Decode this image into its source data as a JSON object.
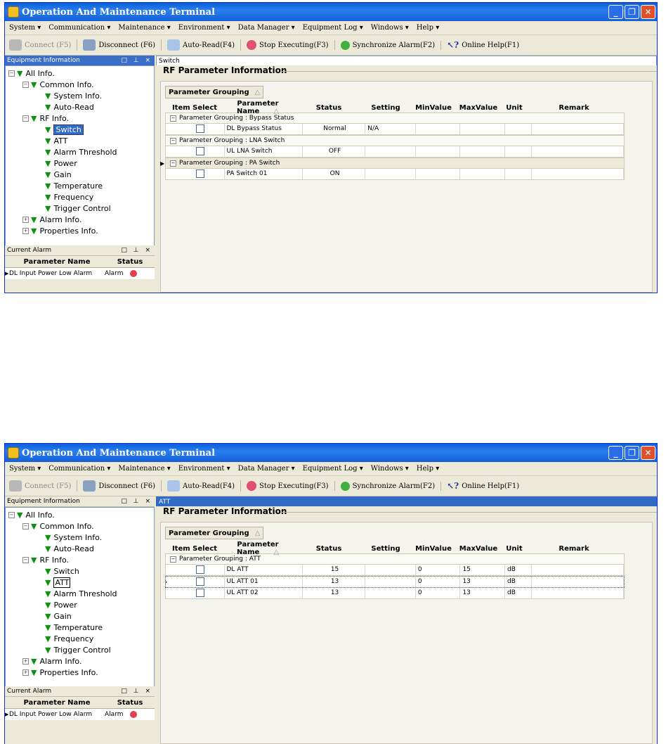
{
  "window1": {
    "title": "Operation And Maintenance Terminal",
    "menu": [
      "System ▾",
      "Communication ▾",
      "Maintenance ▾",
      "Environment ▾",
      "Data Manager ▾",
      "Equipment Log ▾",
      "Windows ▾",
      "Help ▾"
    ],
    "toolbar": {
      "connect": "Connect (F5)",
      "disconnect": "Disconnect (F6)",
      "auto_read": "Auto-Read(F4)",
      "stop": "Stop Executing(F3)",
      "sync": "Synchronize Alarm(F2)",
      "help": "Online Help(F1)"
    },
    "equipment_pane_title": "Equipment Information",
    "pane_controls": "□ ⊥ ×",
    "tree": {
      "all": "All Info.",
      "common": "Common Info.",
      "system": "System Info.",
      "auto_read": "Auto-Read",
      "rf": "RF Info.",
      "switch": "Switch",
      "att": "ATT",
      "alarm_threshold": "Alarm Threshold",
      "power": "Power",
      "gain": "Gain",
      "temperature": "Temperature",
      "frequency": "Frequency",
      "trigger": "Trigger Control",
      "alarm_info": "Alarm Info.",
      "properties": "Properties Info."
    },
    "current_alarm_title": "Current Alarm",
    "alarm_headers": {
      "name": "Parameter Name",
      "status": "Status"
    },
    "alarm_row": {
      "name": "DL Input Power Low Alarm",
      "status": "Alarm"
    },
    "breadcrumb": "Switch",
    "content_title": "RF Parameter Information",
    "grouping_label": "Parameter Grouping",
    "headers": [
      "Item Select",
      "Parameter Name",
      "Status",
      "Setting",
      "MinValue",
      "MaxValue",
      "Unit",
      "Remark"
    ],
    "groups": [
      {
        "label": "Parameter Grouping : Bypass Status",
        "rows": [
          {
            "name": "DL Bypass Status",
            "status": "Normal",
            "setting": "N/A",
            "min": "",
            "max": "",
            "unit": "",
            "remark": ""
          }
        ]
      },
      {
        "label": "Parameter Grouping : LNA Switch",
        "rows": [
          {
            "name": "UL LNA Switch",
            "status": "OFF",
            "setting": "",
            "min": "",
            "max": "",
            "unit": "",
            "remark": ""
          }
        ]
      },
      {
        "label": "Parameter Grouping : PA Switch",
        "rows": [
          {
            "name": "PA Switch 01",
            "status": "ON",
            "setting": "",
            "min": "",
            "max": "",
            "unit": "",
            "remark": ""
          }
        ]
      }
    ]
  },
  "window2": {
    "title": "Operation And Maintenance Terminal",
    "breadcrumb": "ATT",
    "content_title": "RF Parameter Information",
    "grouping_label": "Parameter Grouping",
    "group_label": "Parameter Grouping : ATT",
    "rows": [
      {
        "name": "DL ATT",
        "status": "15",
        "setting": "",
        "min": "0",
        "max": "15",
        "unit": "dB",
        "remark": ""
      },
      {
        "name": "UL ATT 01",
        "status": "13",
        "setting": "",
        "min": "0",
        "max": "13",
        "unit": "dB",
        "remark": ""
      },
      {
        "name": "UL ATT 02",
        "status": "13",
        "setting": "",
        "min": "0",
        "max": "13",
        "unit": "dB",
        "remark": ""
      }
    ]
  },
  "colors": {
    "title_bar": "#0a5fd8",
    "selection": "#316ac5",
    "tick_green": "#109010",
    "alarm_red": "#e04050"
  },
  "icons": [
    "app-icon",
    "connect-icon",
    "disconnect-icon",
    "auto-read-icon",
    "stop-icon",
    "sync-icon",
    "help-icon",
    "check-icon",
    "alarm-dot-icon"
  ]
}
